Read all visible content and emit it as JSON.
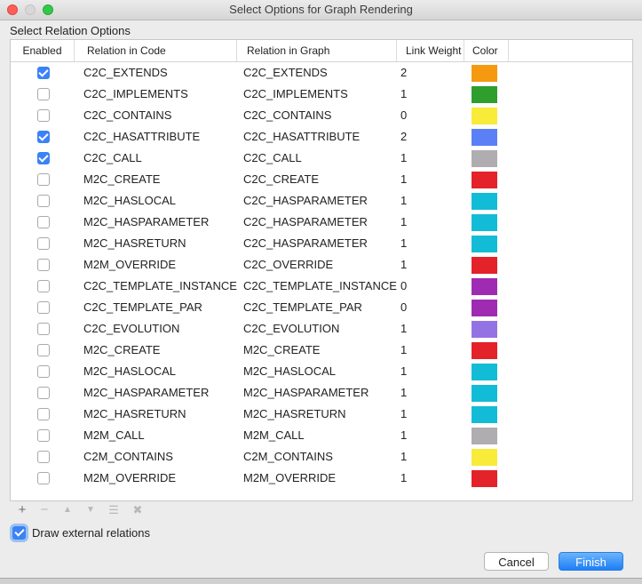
{
  "window": {
    "title": "Select Options for Graph Rendering"
  },
  "section_label": "Select Relation Options",
  "columns": [
    "Enabled",
    "Relation in Code",
    "Relation in Graph",
    "Link Weight",
    "Color"
  ],
  "rows": [
    {
      "enabled": true,
      "code": "C2C_EXTENDS",
      "graph": "C2C_EXTENDS",
      "weight": "2",
      "color": "#f59a10"
    },
    {
      "enabled": false,
      "code": "C2C_IMPLEMENTS",
      "graph": "C2C_IMPLEMENTS",
      "weight": "1",
      "color": "#2e9e2c"
    },
    {
      "enabled": false,
      "code": "C2C_CONTAINS",
      "graph": "C2C_CONTAINS",
      "weight": "0",
      "color": "#f9eb3a"
    },
    {
      "enabled": true,
      "code": "C2C_HASATTRIBUTE",
      "graph": "C2C_HASATTRIBUTE",
      "weight": "2",
      "color": "#5b7ff5"
    },
    {
      "enabled": true,
      "code": "C2C_CALL",
      "graph": "C2C_CALL",
      "weight": "1",
      "color": "#b0adb0"
    },
    {
      "enabled": false,
      "code": "M2C_CREATE",
      "graph": "C2C_CREATE",
      "weight": "1",
      "color": "#e3222a"
    },
    {
      "enabled": false,
      "code": "M2C_HASLOCAL",
      "graph": "C2C_HASPARAMETER",
      "weight": "1",
      "color": "#12bcd6"
    },
    {
      "enabled": false,
      "code": "M2C_HASPARAMETER",
      "graph": "C2C_HASPARAMETER",
      "weight": "1",
      "color": "#12bcd6"
    },
    {
      "enabled": false,
      "code": "M2C_HASRETURN",
      "graph": "C2C_HASPARAMETER",
      "weight": "1",
      "color": "#12bcd6"
    },
    {
      "enabled": false,
      "code": "M2M_OVERRIDE",
      "graph": "C2C_OVERRIDE",
      "weight": "1",
      "color": "#e3222a"
    },
    {
      "enabled": false,
      "code": "C2C_TEMPLATE_INSTANCE",
      "graph": "C2C_TEMPLATE_INSTANCE",
      "weight": "0",
      "color": "#a02bb3"
    },
    {
      "enabled": false,
      "code": "C2C_TEMPLATE_PAR",
      "graph": "C2C_TEMPLATE_PAR",
      "weight": "0",
      "color": "#a02bb3"
    },
    {
      "enabled": false,
      "code": "C2C_EVOLUTION",
      "graph": "C2C_EVOLUTION",
      "weight": "1",
      "color": "#9373e3"
    },
    {
      "enabled": false,
      "code": "M2C_CREATE",
      "graph": "M2C_CREATE",
      "weight": "1",
      "color": "#e3222a"
    },
    {
      "enabled": false,
      "code": "M2C_HASLOCAL",
      "graph": "M2C_HASLOCAL",
      "weight": "1",
      "color": "#12bcd6"
    },
    {
      "enabled": false,
      "code": "M2C_HASPARAMETER",
      "graph": "M2C_HASPARAMETER",
      "weight": "1",
      "color": "#12bcd6"
    },
    {
      "enabled": false,
      "code": "M2C_HASRETURN",
      "graph": "M2C_HASRETURN",
      "weight": "1",
      "color": "#12bcd6"
    },
    {
      "enabled": false,
      "code": "M2M_CALL",
      "graph": "M2M_CALL",
      "weight": "1",
      "color": "#b0adb0"
    },
    {
      "enabled": false,
      "code": "C2M_CONTAINS",
      "graph": "C2M_CONTAINS",
      "weight": "1",
      "color": "#f9eb3a"
    },
    {
      "enabled": false,
      "code": "M2M_OVERRIDE",
      "graph": "M2M_OVERRIDE",
      "weight": "1",
      "color": "#e3222a"
    }
  ],
  "toolbar": {
    "add_icon": "plus-icon",
    "add_symbol": "+",
    "remove_icon": "minus-icon",
    "remove_symbol": "−",
    "up_icon": "arrow-up-icon",
    "up_symbol": "▲",
    "down_icon": "arrow-down-icon",
    "down_symbol": "▼",
    "tree_icon": "tree-list-icon",
    "tree_symbol": "☰",
    "clear_icon": "clear-icon",
    "clear_symbol": "✖"
  },
  "external_relations": {
    "checked": true,
    "label": "Draw external relations"
  },
  "buttons": {
    "cancel": "Cancel",
    "finish": "Finish"
  },
  "accent_color": "#3b82f6"
}
